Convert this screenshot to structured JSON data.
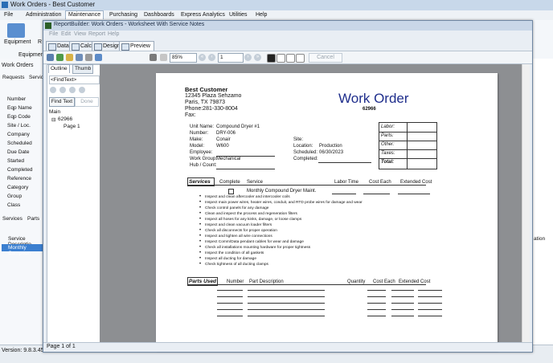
{
  "app": {
    "title": "Work Orders - Best Customer",
    "menu": [
      "File",
      "Administration",
      "Maintenance",
      "Purchasing",
      "Dashboards",
      "Express Analytics",
      "Utilities",
      "Help"
    ],
    "active_menu": "Maintenance",
    "ribbon_equipment": "Equipment",
    "ribbon_equipment_group": "Equipment",
    "ribbon_r": "R",
    "tab_work_orders": "Work Orders",
    "requests_label": "Requests",
    "service_label": "Service",
    "fields": [
      "Number",
      "Eqp Name",
      "Eqp Code",
      "Site / Loc.",
      "Company",
      "Scheduled",
      "Due Date",
      "Started",
      "Completed",
      "Reference",
      "Category",
      "Group",
      "Class"
    ],
    "bottom_tabs": [
      "Services",
      "Parts"
    ],
    "service_desc_header": "Service Descriptio",
    "service_row": "Monthly Compoun",
    "right_header": "ation",
    "version": "Version: 9.8.3.45"
  },
  "rb": {
    "title": "ReportBuilder: Work Orders - Worksheet With Service Notes",
    "menu": [
      "File",
      "Edit",
      "View",
      "Report",
      "Help"
    ],
    "tabs": [
      "Data",
      "Calc",
      "Design",
      "Preview"
    ],
    "active_tab": "Preview",
    "zoom": "85%",
    "page_number": "1",
    "cancel": "Cancel",
    "outline_tabs": [
      "Outline",
      "Thumb"
    ],
    "find_placeholder": "<FindText>",
    "find_text": "Find Text",
    "done": "Done",
    "tree": [
      "Main",
      "62966",
      "Page 1"
    ],
    "status": "Page 1 of 1"
  },
  "report": {
    "company": "Best Customer",
    "address1": "12345 Plaza Sehzamo",
    "address2": "Paris, TX  79873",
    "phone": "Phone:281-330-8004",
    "fax": "Fax:",
    "heading": "Work Order",
    "wo_number": "62966",
    "left_labels": [
      "Unit Name:",
      "Number:",
      "Make:",
      "Model:",
      "Employee:",
      "Work Group:",
      "Hub / Count:"
    ],
    "left_values": [
      "Compound Dryer #1",
      "DRY-006",
      "Conair",
      "W600",
      "",
      "Mechanical",
      ""
    ],
    "mid_labels": [
      "Site:",
      "Location:",
      "Scheduled:",
      "Completed:"
    ],
    "mid_values": [
      "",
      "Production",
      "06/30/2023",
      ""
    ],
    "box_labels": [
      "Labor:",
      "Parts:",
      "Other:",
      "Taxes:",
      "Total:"
    ],
    "services_title": "Services",
    "services_cols": [
      "Complete",
      "Service",
      "Labor Time",
      "Cost Each",
      "Extended Cost"
    ],
    "service_name": "Monthly Compound Dryer Maint.",
    "tasks": [
      "Inspect and clean aftercooler and intercooler coils",
      "Inspect main power wires, heater wires, conduit, and RTD probe wires for damage and wear",
      "Check control panels for any damage",
      "Clean and inspect the process and regeneration filters",
      "Inspect all hoses for any kinks, damage, or loose clamps",
      "Inspect and clean vacuum loader filters",
      "Check all disconnects for proper operation",
      "Inspect and tighten all wire connections",
      "Inspect Comm/Data pendant cables for wear and damage",
      "Check all installations mounting hardware for proper tightness",
      "Inspect the condition of all gaskets",
      "Inspect all ducting for damage",
      "Check tightness of all ducting clamps"
    ],
    "parts_title": "Parts Used",
    "parts_cols": [
      "Number",
      "Part Description",
      "Quantity",
      "Cost Each",
      "Extended Cost"
    ]
  }
}
